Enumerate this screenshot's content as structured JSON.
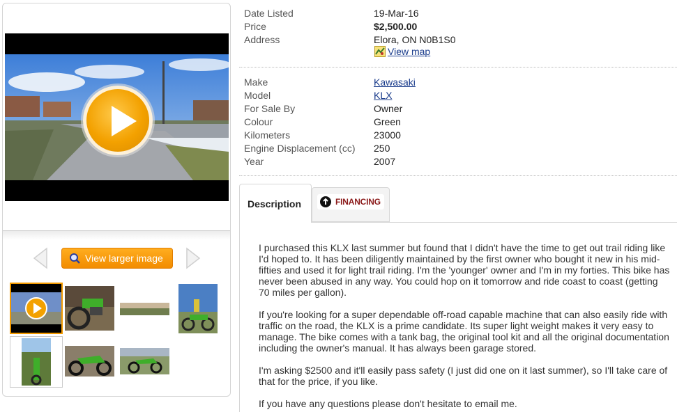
{
  "media": {
    "larger_image_label": "View larger image"
  },
  "details": {
    "date_listed": {
      "label": "Date Listed",
      "value": "19-Mar-16"
    },
    "price": {
      "label": "Price",
      "value": "$2,500.00"
    },
    "address": {
      "label": "Address",
      "value": "Elora, ON N0B1S0",
      "map_link": "View map"
    },
    "make": {
      "label": "Make",
      "value": "Kawasaki"
    },
    "model": {
      "label": "Model",
      "value": "KLX"
    },
    "for_sale_by": {
      "label": "For Sale By",
      "value": "Owner"
    },
    "colour": {
      "label": "Colour",
      "value": "Green"
    },
    "kilometers": {
      "label": "Kilometers",
      "value": "23000"
    },
    "engine": {
      "label": "Engine Displacement (cc)",
      "value": "250"
    },
    "year": {
      "label": "Year",
      "value": "2007"
    }
  },
  "tabs": {
    "description": "Description",
    "financing": "FINANCING"
  },
  "description": {
    "p1": "I purchased this KLX last summer but found that I didn't have the time to get out trail riding like I'd hoped to. It has been diligently maintained by the first owner who bought it new in his mid-fifties and used it for light trail riding. I'm the 'younger' owner and I'm in my forties. This bike has never been abused in any way. You could hop on it tomorrow and ride coast to coast (getting 70 miles per gallon).",
    "p2": "If you're looking for a super dependable off-road capable machine that can also easily ride with traffic on the road, the KLX is a prime candidate. Its super light weight makes it very easy to manage. The bike comes with a tank bag, the original tool kit and all the original documentation including the owner's manual. It has always been garage stored.",
    "p3": "I'm asking $2500 and it'll easily pass safety (I just did one on it last summer), so I'll take care of that for the price, if you like.",
    "p4": "If you have any questions please don't hesitate to email me."
  },
  "colors": {
    "accent_orange": "#f39a00",
    "link_blue": "#1a3c8c",
    "bike_green": "#3fae2a"
  }
}
